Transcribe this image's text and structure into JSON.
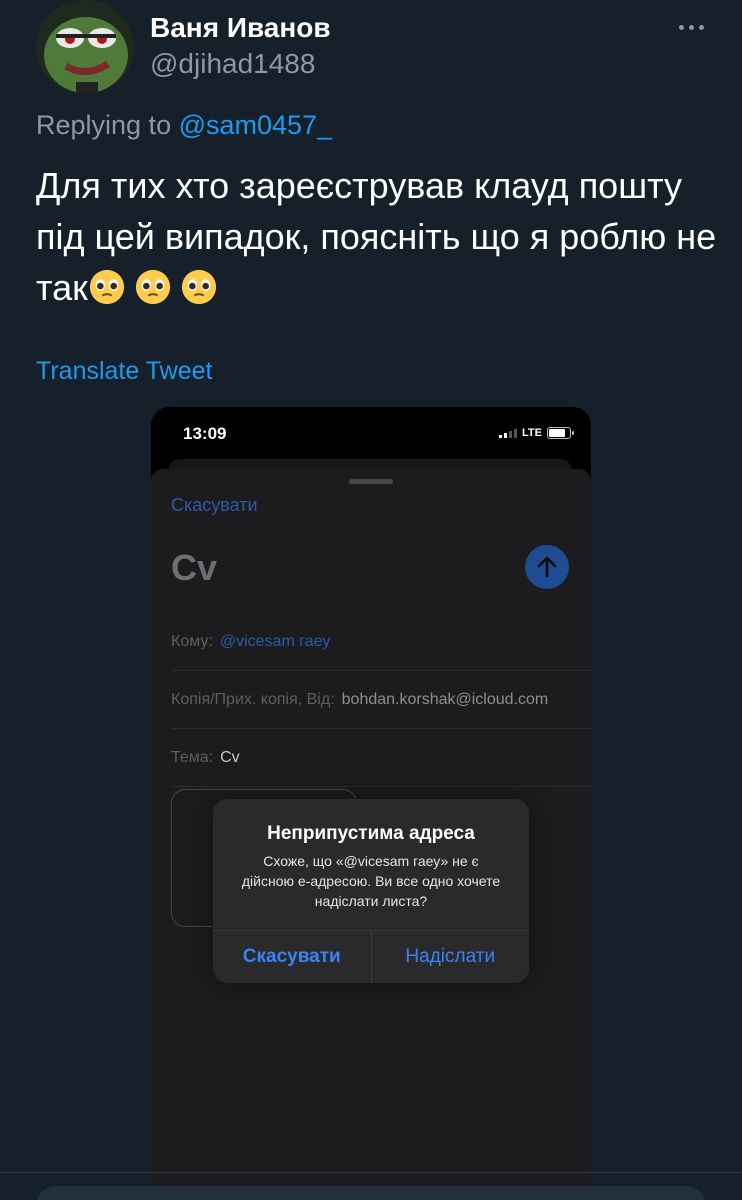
{
  "author": {
    "display_name": "Ваня Иванов",
    "handle": "@djihad1488"
  },
  "reply": {
    "prefix": "Replying to ",
    "mention": "@sam0457_"
  },
  "tweet": {
    "text": "Для тих хто зареєстрував клауд пошту під цей випадок, поясніть що я роблю не так",
    "translate_label": "Translate Tweet"
  },
  "phone": {
    "time": "13:09",
    "network": "LTE",
    "cancel": "Скасувати",
    "subject_big": "Cv",
    "to_label": "Кому:",
    "to_value": "@vicesam гаеу",
    "cc_label": "Копія/Прих. копія, Від:",
    "cc_value": "bohdan.korshak@icloud.com",
    "subject_label": "Тема:",
    "subject_value": "Cv",
    "alert": {
      "title": "Неприпустима адреса",
      "message": "Схоже, що «@vicesam гаеу» не є дійсною е-адресою. Ви все одно хочете надіслати листа?",
      "cancel_button": "Скасувати",
      "send_button": "Надіслати"
    }
  },
  "colors": {
    "background": "#15202b",
    "accent": "#1d9bf0",
    "secondary_text": "#8b98a5"
  }
}
